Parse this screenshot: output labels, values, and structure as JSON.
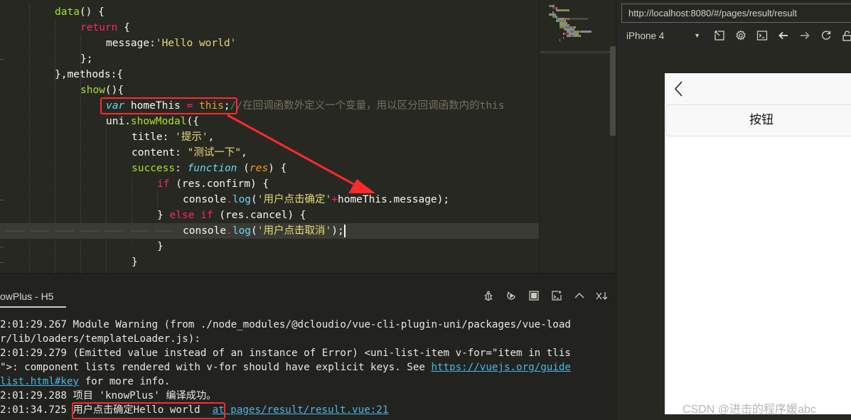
{
  "editor": {
    "lines": [
      {
        "indent": 2,
        "tokens": [
          {
            "t": "data",
            "c": "fn"
          },
          {
            "t": "() {",
            "c": "punct"
          }
        ]
      },
      {
        "indent": 3,
        "tokens": [
          {
            "t": "return",
            "c": "kw"
          },
          {
            "t": " {",
            "c": "punct"
          }
        ]
      },
      {
        "indent": 4,
        "tokens": [
          {
            "t": "message:",
            "c": "punct"
          },
          {
            "t": "'Hello world'",
            "c": "str"
          }
        ]
      },
      {
        "indent": 3,
        "tokens": [
          {
            "t": "};",
            "c": "punct"
          }
        ]
      },
      {
        "indent": 2,
        "tokens": [
          {
            "t": "},methods:{",
            "c": "punct"
          }
        ]
      },
      {
        "indent": 3,
        "tokens": [
          {
            "t": "show",
            "c": "fn"
          },
          {
            "t": "(){",
            "c": "punct"
          }
        ]
      },
      {
        "indent": 4,
        "tokens": [
          {
            "t": "var",
            "c": "storage"
          },
          {
            "t": " homeThis ",
            "c": "punct"
          },
          {
            "t": "=",
            "c": "op"
          },
          {
            "t": " ",
            "c": "punct"
          },
          {
            "t": "this",
            "c": "this"
          },
          {
            "t": ";",
            "c": "punct"
          },
          {
            "t": "//在回调函数外定义一个变量，用以区分回调函数内的this",
            "c": "comment"
          }
        ]
      },
      {
        "indent": 4,
        "tokens": [
          {
            "t": "uni.",
            "c": "punct"
          },
          {
            "t": "showModal",
            "c": "fn"
          },
          {
            "t": "({",
            "c": "punct"
          }
        ]
      },
      {
        "indent": 5,
        "tokens": [
          {
            "t": "title: ",
            "c": "punct"
          },
          {
            "t": "'提示'",
            "c": "str"
          },
          {
            "t": ",",
            "c": "punct"
          }
        ]
      },
      {
        "indent": 5,
        "tokens": [
          {
            "t": "content: ",
            "c": "punct"
          },
          {
            "t": "\"测试一下\"",
            "c": "str"
          },
          {
            "t": ",",
            "c": "punct"
          }
        ]
      },
      {
        "indent": 5,
        "tokens": [
          {
            "t": "success",
            "c": "fn"
          },
          {
            "t": ": ",
            "c": "punct"
          },
          {
            "t": "function",
            "c": "storage"
          },
          {
            "t": " (",
            "c": "punct"
          },
          {
            "t": "res",
            "c": "param"
          },
          {
            "t": ") {",
            "c": "punct"
          }
        ]
      },
      {
        "indent": 6,
        "tokens": [
          {
            "t": "if",
            "c": "kw"
          },
          {
            "t": " (res.confirm) {",
            "c": "punct"
          }
        ]
      },
      {
        "indent": 7,
        "tokens": [
          {
            "t": "console",
            "c": "punct"
          },
          {
            "t": ".",
            "c": "op"
          },
          {
            "t": "log",
            "c": "method"
          },
          {
            "t": "(",
            "c": "punct"
          },
          {
            "t": "'用户点击确定'",
            "c": "str"
          },
          {
            "t": "+",
            "c": "op"
          },
          {
            "t": "homeThis.message);",
            "c": "punct"
          }
        ]
      },
      {
        "indent": 6,
        "tokens": [
          {
            "t": "} ",
            "c": "punct"
          },
          {
            "t": "else if",
            "c": "kw"
          },
          {
            "t": " (res.cancel) {",
            "c": "punct"
          }
        ]
      },
      {
        "indent": 7,
        "active": true,
        "tokens": [
          {
            "t": "console",
            "c": "punct"
          },
          {
            "t": ".",
            "c": "op"
          },
          {
            "t": "log",
            "c": "method"
          },
          {
            "t": "(",
            "c": "punct"
          },
          {
            "t": "'用户点击取消'",
            "c": "str"
          },
          {
            "t": ");",
            "c": "punct"
          }
        ]
      },
      {
        "indent": 6,
        "tokens": [
          {
            "t": "}",
            "c": "punct"
          }
        ]
      },
      {
        "indent": 5,
        "tokens": [
          {
            "t": "}",
            "c": "punct"
          }
        ]
      }
    ]
  },
  "console": {
    "tab_label": "owPlus - H5",
    "tools": [
      {
        "name": "debug-icon",
        "glyph": "bug"
      },
      {
        "name": "run-icon",
        "glyph": "run"
      },
      {
        "name": "stop-icon",
        "glyph": "stop"
      },
      {
        "name": "new-terminal-icon",
        "glyph": "terminal-plus"
      },
      {
        "name": "maximize-panel-icon",
        "glyph": "chevron-up"
      },
      {
        "name": "clear-console-icon",
        "glyph": "x-down"
      }
    ],
    "log": [
      {
        "time": "2:01:29.267",
        "text": " Module Warning (from ./node_modules/@dcloudio/vue-cli-plugin-uni/packages/vue-load"
      },
      {
        "time": "",
        "text": "r/lib/loaders/templateLoader.js):"
      },
      {
        "time": "2:01:29.279",
        "text": " (Emitted value instead of an instance of Error) <uni-list-item v-for=\"item in tlis"
      },
      {
        "time": "",
        "text": "\">: component lists rendered with v-for should have explicit keys. See ",
        "link": "https://vuejs.org/guide"
      },
      {
        "time": "",
        "text": "",
        "link": "list.html#key",
        "after": " for more info."
      },
      {
        "time": "2:01:29.288",
        "text": " 项目 'knowPlus' 编译成功。"
      },
      {
        "time": "2:01:34.725",
        "text": " 用户点击确定Hello world  ",
        "link": "at pages/result/result.vue:21"
      }
    ]
  },
  "preview": {
    "url": "http://localhost:8080/#/pages/result/result",
    "device": "iPhone 4",
    "tools": [
      "rotate-icon",
      "settings-icon",
      "devtools-console-icon",
      "back-arrow-icon",
      "forward-arrow-icon",
      "reload-icon",
      "unlock-icon"
    ],
    "page": {
      "button_label": "按钮"
    }
  },
  "watermark": "CSDN @进击的程序媛abc",
  "annotation": {
    "color": "#ff2a2a"
  }
}
